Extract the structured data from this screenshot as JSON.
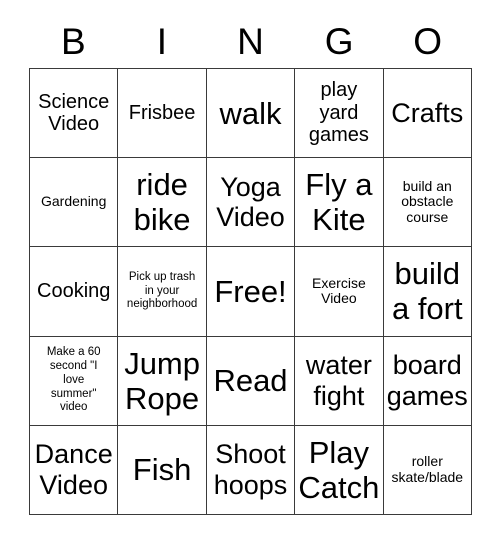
{
  "card": {
    "title": "BINGO Card",
    "background_color": "#ffffff",
    "text_color": "#000000",
    "border_color": "#3a3a3a"
  },
  "header": {
    "letters": [
      "B",
      "I",
      "N",
      "G",
      "O"
    ]
  },
  "grid": {
    "columns": 5,
    "rows": 5,
    "free_space": "Free!",
    "cells": [
      {
        "text": "Science\nVideo",
        "size": "md",
        "row": 1,
        "col": 1,
        "column_letter": "B"
      },
      {
        "text": "Frisbee",
        "size": "md",
        "row": 1,
        "col": 2,
        "column_letter": "I"
      },
      {
        "text": "walk",
        "size": "xl",
        "row": 1,
        "col": 3,
        "column_letter": "N"
      },
      {
        "text": "play\nyard\ngames",
        "size": "md",
        "row": 1,
        "col": 4,
        "column_letter": "G"
      },
      {
        "text": "Crafts",
        "size": "lg",
        "row": 1,
        "col": 5,
        "column_letter": "O"
      },
      {
        "text": "Gardening",
        "size": "sm",
        "row": 2,
        "col": 1,
        "column_letter": "B"
      },
      {
        "text": "ride\nbike",
        "size": "xl",
        "row": 2,
        "col": 2,
        "column_letter": "I"
      },
      {
        "text": "Yoga\nVideo",
        "size": "lg",
        "row": 2,
        "col": 3,
        "column_letter": "N"
      },
      {
        "text": "Fly a\nKite",
        "size": "xl",
        "row": 2,
        "col": 4,
        "column_letter": "G"
      },
      {
        "text": "build an\nobstacle\ncourse",
        "size": "sm",
        "row": 2,
        "col": 5,
        "column_letter": "O"
      },
      {
        "text": "Cooking",
        "size": "md",
        "row": 3,
        "col": 1,
        "column_letter": "B"
      },
      {
        "text": "Pick up trash\nin your\nneighborhood",
        "size": "xs",
        "row": 3,
        "col": 2,
        "column_letter": "I"
      },
      {
        "text": "Free!",
        "size": "xl",
        "row": 3,
        "col": 3,
        "column_letter": "N"
      },
      {
        "text": "Exercise\nVideo",
        "size": "sm",
        "row": 3,
        "col": 4,
        "column_letter": "G"
      },
      {
        "text": "build\na fort",
        "size": "xl",
        "row": 3,
        "col": 5,
        "column_letter": "O"
      },
      {
        "text": "Make a 60\nsecond \"I\nlove\nsummer\"\nvideo",
        "size": "xs",
        "row": 4,
        "col": 1,
        "column_letter": "B"
      },
      {
        "text": "Jump\nRope",
        "size": "xl",
        "row": 4,
        "col": 2,
        "column_letter": "I"
      },
      {
        "text": "Read",
        "size": "xl",
        "row": 4,
        "col": 3,
        "column_letter": "N"
      },
      {
        "text": "water\nfight",
        "size": "lg",
        "row": 4,
        "col": 4,
        "column_letter": "G"
      },
      {
        "text": "board\ngames",
        "size": "lg",
        "row": 4,
        "col": 5,
        "column_letter": "O"
      },
      {
        "text": "Dance\nVideo",
        "size": "lg",
        "row": 5,
        "col": 1,
        "column_letter": "B"
      },
      {
        "text": "Fish",
        "size": "xl",
        "row": 5,
        "col": 2,
        "column_letter": "I"
      },
      {
        "text": "Shoot\nhoops",
        "size": "lg",
        "row": 5,
        "col": 3,
        "column_letter": "N"
      },
      {
        "text": "Play\nCatch",
        "size": "xl",
        "row": 5,
        "col": 4,
        "column_letter": "G"
      },
      {
        "text": "roller\nskate/blade",
        "size": "sm",
        "row": 5,
        "col": 5,
        "column_letter": "O"
      }
    ]
  }
}
